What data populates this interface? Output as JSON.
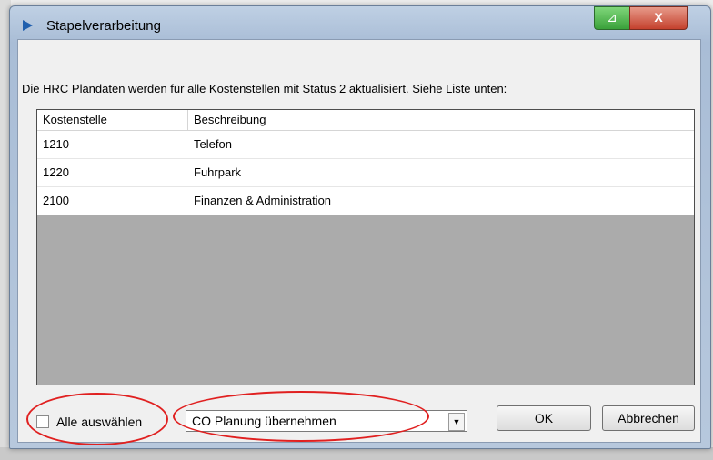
{
  "window": {
    "title": "Stapelverarbeitung",
    "minimize_glyph": "⊿",
    "close_glyph": "X"
  },
  "info_text": "Die HRC Plandaten werden für alle Kostenstellen mit Status 2 aktualisiert. Siehe Liste unten:",
  "list": {
    "columns": [
      "Kostenstelle",
      "Beschreibung"
    ],
    "rows": [
      [
        "1210",
        "Telefon"
      ],
      [
        "1220",
        "Fuhrpark"
      ],
      [
        "2100",
        "Finanzen & Administration"
      ]
    ]
  },
  "select_all": {
    "label": "Alle auswählen",
    "checked": false
  },
  "mode_combo": {
    "value": "CO Planung übernehmen"
  },
  "buttons": {
    "ok": "OK",
    "cancel": "Abbrechen"
  },
  "colors": {
    "annotation": "#e02020",
    "list_background": "#ababab"
  }
}
